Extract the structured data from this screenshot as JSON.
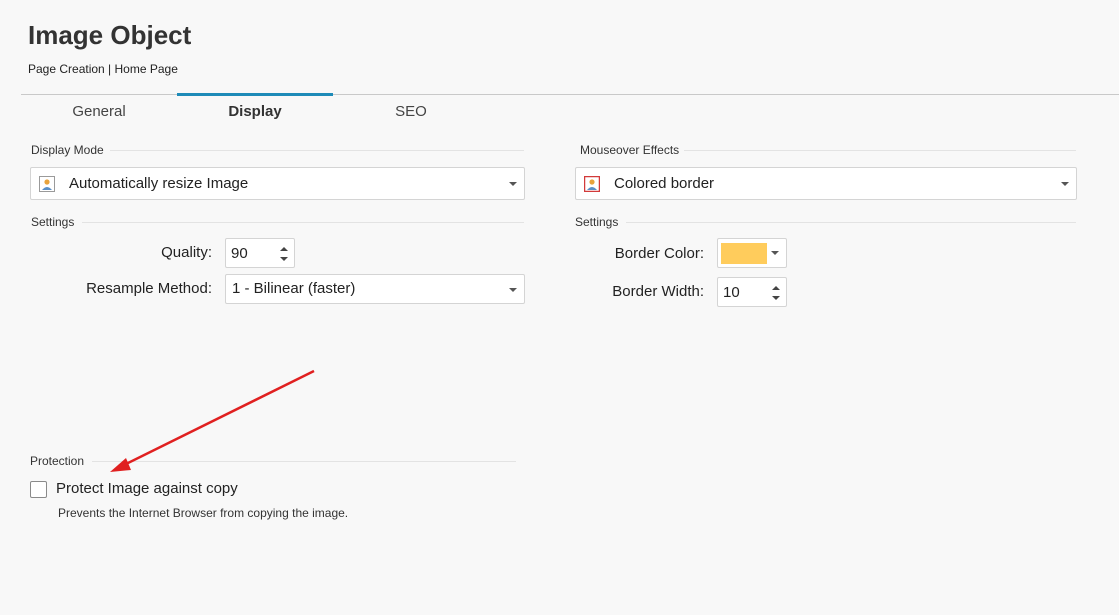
{
  "header": {
    "title": "Image Object",
    "breadcrumb": "Page Creation | Home Page"
  },
  "tabs": [
    {
      "label": "General",
      "active": false
    },
    {
      "label": "Display",
      "active": true
    },
    {
      "label": "SEO",
      "active": false
    }
  ],
  "display_mode": {
    "section_label": "Display Mode",
    "selected": "Automatically resize Image",
    "icon": "image-icon"
  },
  "left_settings": {
    "section_label": "Settings",
    "quality_label": "Quality:",
    "quality_value": "90",
    "resample_label": "Resample Method:",
    "resample_value": "1 - Bilinear (faster)"
  },
  "mouseover": {
    "section_label": "Mouseover Effects",
    "selected": "Colored border",
    "icon": "image-border-icon"
  },
  "right_settings": {
    "section_label": "Settings",
    "border_color_label": "Border Color:",
    "border_color_value": "#ffcc5c",
    "border_width_label": "Border Width:",
    "border_width_value": "10"
  },
  "protection": {
    "section_label": "Protection",
    "checkbox_label": "Protect Image against copy",
    "checked": false,
    "description": "Prevents the Internet Browser from copying the image."
  },
  "colors": {
    "accent": "#1e8bb8",
    "annotation_arrow": "#e02020"
  }
}
